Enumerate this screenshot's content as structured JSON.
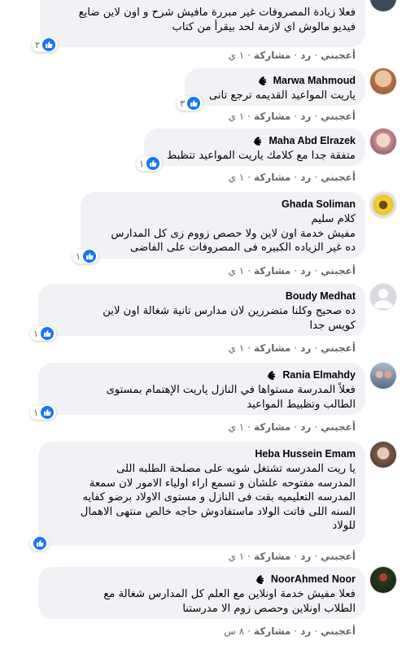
{
  "actions": {
    "like": "أعجبني",
    "reply": "رد",
    "share": "مشاركة",
    "sep": "·"
  },
  "comments": [
    {
      "name": "",
      "text": "فعلا زيادة المصروفات غير مبررة مافيش شرح و اون لاين ضايع\nفيديو مالوش اي لازمة لحد بيقرأ من كتاب",
      "reactions": "٢",
      "reaction_icon": "like-icon",
      "time": "١ ي"
    },
    {
      "name": "Marwa Mahmoud",
      "text": "ياريت المواعيد القديمه ترجع تانى",
      "reactions": "٣",
      "reaction_icon": "like-icon",
      "time": "١ ي"
    },
    {
      "name": "Maha Abd Elrazek",
      "text": "متفقة جدا مع كلامك ياريت المواعيد تتظبط",
      "reactions": "١",
      "reaction_icon": "like-icon",
      "time": "١ ي"
    },
    {
      "name": "Ghada Soliman",
      "text": "كلام سليم\nمفيش خدمة اون لاين ولا حصص زووم زى كل المدارس\nده غير الزياده الكبيره فى المصروفات على الفاضى",
      "reactions": "١",
      "reaction_icon": "like-icon",
      "time": "١ ي"
    },
    {
      "name": "Boudy Medhat",
      "text": "ده صحيح وكلنا متضررين لان مدارس تانية شغالة اون لاين\nكويس جدا",
      "reactions": "١",
      "reaction_icon": "like-icon",
      "time": "١ ي"
    },
    {
      "name": "Rania Elmahdy",
      "text": "فعلاً المدرسة مستواها في النازل ياريت الإهتمام بمستوى\nالطالب وتظبيط المواعيد",
      "reactions": "١",
      "reaction_icon": "like-icon",
      "time": "١ ي"
    },
    {
      "name": "Heba Hussein Emam",
      "text": "يا ريت المدرسه تشتغل شويه على مصلحة الطلبه اللى\nالمدرسه مفتوحه علشان و تسمع اراء اولياء الامور لان سمعة\nالمدرسه التعليميه بقت فى النازل و مستوى الاولاد برضو كفايه\nالسنه اللى فاتت الولاد ماستفادوش حاجه خالص منتهى الاهمال\nللولاد",
      "reactions": "",
      "reaction_icon": "like-icon",
      "time": "١ ي"
    },
    {
      "name": "NoorAhmed Noor",
      "text": "فعلا مفيش خدمة اونلاين مع العلم كل المدارس شغالة مع\nالطلاب اونلاين وحصص زوم الا مدرستنا",
      "reactions": "",
      "reaction_icon": "",
      "time": "٨ س"
    }
  ]
}
